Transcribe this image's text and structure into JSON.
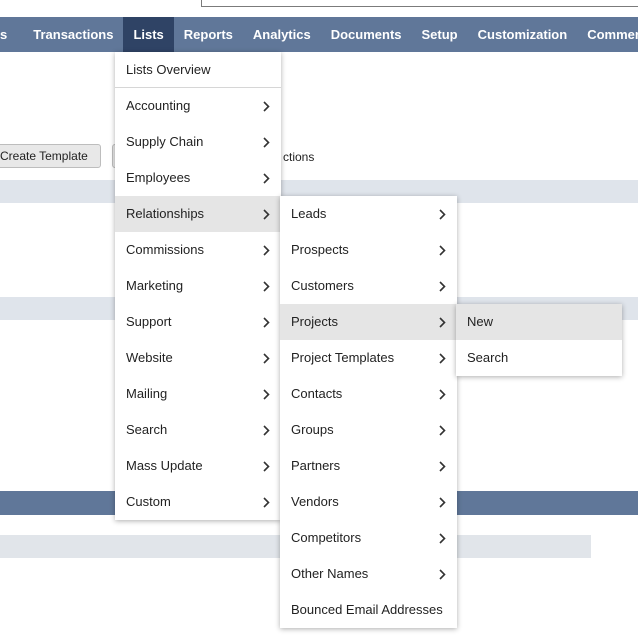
{
  "navbar": {
    "items": [
      "s",
      "Transactions",
      "Lists",
      "Reports",
      "Analytics",
      "Documents",
      "Setup",
      "Customization",
      "Commerce"
    ]
  },
  "page": {
    "create_template_label": "Create Template",
    "actions_text": "ctions"
  },
  "lists_menu": {
    "header": "Lists Overview",
    "items": [
      "Accounting",
      "Supply Chain",
      "Employees",
      "Relationships",
      "Commissions",
      "Marketing",
      "Support",
      "Website",
      "Mailing",
      "Search",
      "Mass Update",
      "Custom"
    ]
  },
  "relationships_menu": {
    "items": [
      "Leads",
      "Prospects",
      "Customers",
      "Projects",
      "Project Templates",
      "Contacts",
      "Groups",
      "Partners",
      "Vendors",
      "Competitors",
      "Other Names",
      "Bounced Email Addresses"
    ]
  },
  "projects_menu": {
    "items": [
      "New",
      "Search"
    ]
  },
  "icons": {
    "submenu": "chevron-right-icon"
  },
  "colors": {
    "navbar": "#607799",
    "navbar_active": "#2f4365",
    "hover": "#e5e5e5"
  }
}
